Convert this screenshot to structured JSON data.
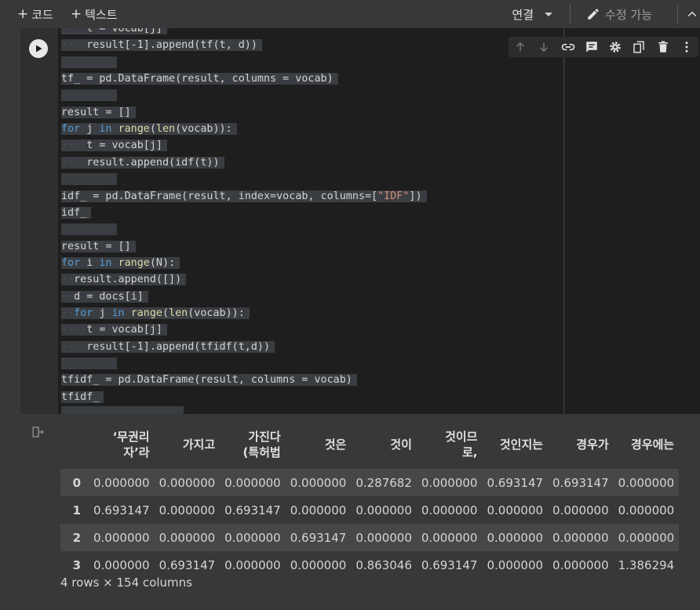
{
  "toolbar": {
    "add_code": "코드",
    "add_text": "텍스트",
    "connect": "연결",
    "edit_mode": "수정 가능"
  },
  "code_lines": [
    {
      "text": "    t = vocab[j]"
    },
    {
      "text": "    result[-1].append(tf(t, d))"
    },
    {
      "text": ""
    },
    {
      "text": "tf_ = pd.DataFrame(result, columns = vocab)"
    },
    {
      "text": ""
    },
    {
      "text": "result = []"
    },
    {
      "text": "for j in range(len(vocab)):"
    },
    {
      "text": "    t = vocab[j]"
    },
    {
      "text": "    result.append(idf(t))"
    },
    {
      "text": ""
    },
    {
      "text": "idf_ = pd.DataFrame(result, index=vocab, columns=[\"IDF\"])"
    },
    {
      "text": "idf_"
    },
    {
      "text": ""
    },
    {
      "text": "result = []"
    },
    {
      "text": "for i in range(N):"
    },
    {
      "text": "  result.append([])"
    },
    {
      "text": "  d = docs[i]"
    },
    {
      "text": "  for j in range(len(vocab)):"
    },
    {
      "text": "    t = vocab[j]"
    },
    {
      "text": "    result[-1].append(tfidf(t,d))"
    },
    {
      "text": ""
    },
    {
      "text": "tfidf_ = pd.DataFrame(result, columns = vocab)"
    },
    {
      "text": "tfidf_"
    }
  ],
  "table": {
    "columns": [
      "‘무권리\n자’라",
      "가지고",
      "가진다\n(특허법",
      "것은",
      "것이",
      "것이므\n로,",
      "것인지는",
      "경우가",
      "경우에는"
    ],
    "rows": [
      {
        "index": "0",
        "values": [
          "0.000000",
          "0.000000",
          "0.000000",
          "0.000000",
          "0.287682",
          "0.000000",
          "0.693147",
          "0.693147",
          "0.000000"
        ]
      },
      {
        "index": "1",
        "values": [
          "0.693147",
          "0.000000",
          "0.693147",
          "0.000000",
          "0.000000",
          "0.000000",
          "0.000000",
          "0.000000",
          "0.000000"
        ]
      },
      {
        "index": "2",
        "values": [
          "0.000000",
          "0.000000",
          "0.000000",
          "0.693147",
          "0.000000",
          "0.000000",
          "0.000000",
          "0.000000",
          "0.000000"
        ]
      },
      {
        "index": "3",
        "values": [
          "0.000000",
          "0.693147",
          "0.000000",
          "0.000000",
          "0.863046",
          "0.693147",
          "0.000000",
          "0.000000",
          "1.386294"
        ]
      }
    ],
    "summary": "4 rows × 154 columns"
  },
  "icons": {
    "run": "play-icon",
    "tools": [
      "arrow-up-icon",
      "arrow-down-icon",
      "link-icon",
      "comment-icon",
      "gear-icon",
      "mirror-cell-icon",
      "trash-icon",
      "more-vert-icon"
    ]
  }
}
